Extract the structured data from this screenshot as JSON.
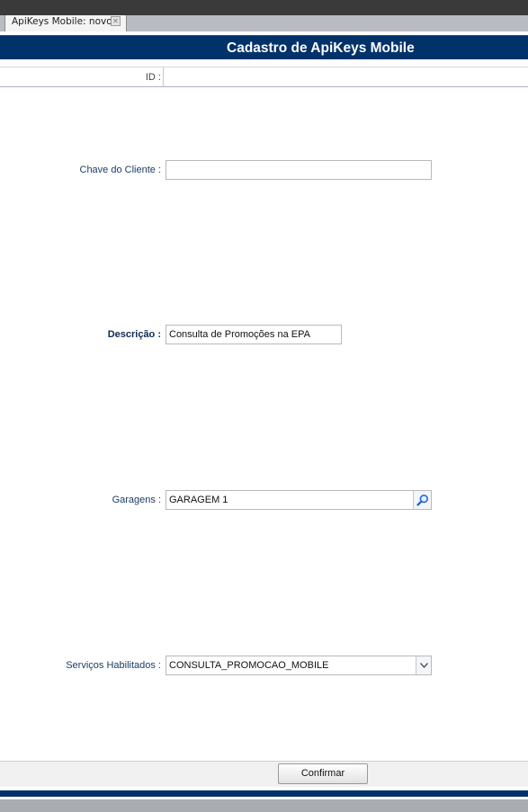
{
  "tab": {
    "label": "ApiKeys Mobile: novo",
    "close_icon": "close-icon"
  },
  "header": {
    "title": "Cadastro de ApiKeys Mobile"
  },
  "form": {
    "id": {
      "label": "ID :",
      "value": ""
    },
    "chave_cliente": {
      "label": "Chave do Cliente :",
      "value": ""
    },
    "descricao": {
      "label": "Descrição :",
      "value": "Consulta de Promoções na EPA"
    },
    "garagens": {
      "label": "Garagens :",
      "value": "GARAGEM 1",
      "icon": "search-icon"
    },
    "servicos": {
      "label": "Serviços Habilitados :",
      "selected": "CONSULTA_PROMOCAO_MOBILE",
      "icon": "chevron-down-icon"
    }
  },
  "footer": {
    "confirm_label": "Confirmar"
  },
  "colors": {
    "brand": "#02326a",
    "label": "#1d3d66",
    "tab_strip": "#b9bcc2"
  }
}
